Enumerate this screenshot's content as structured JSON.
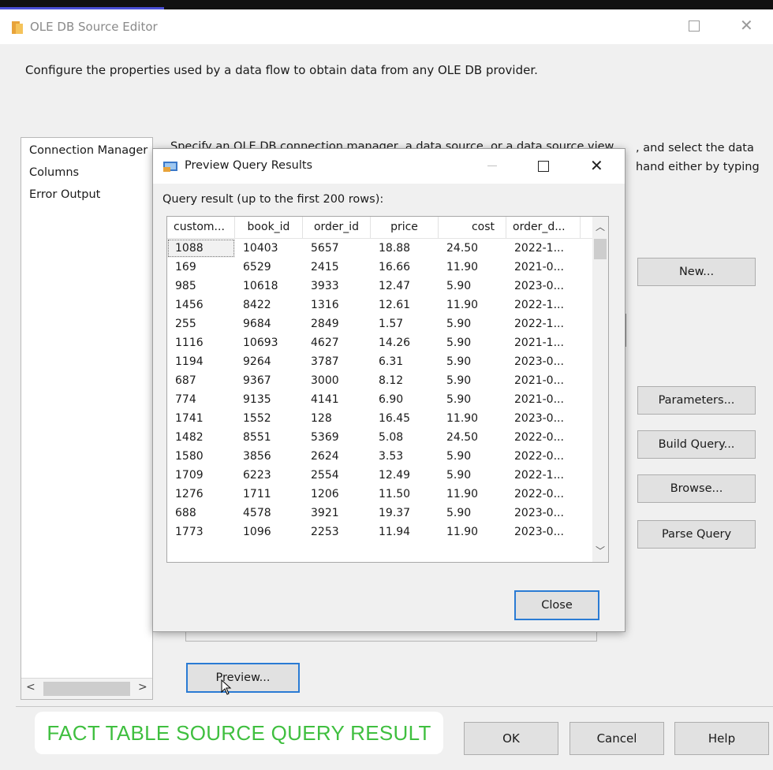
{
  "window": {
    "title": "OLE DB Source Editor",
    "description": "Configure the properties used by a data flow to obtain data from any OLE DB provider."
  },
  "nav": {
    "items": [
      "Connection Manager",
      "Columns",
      "Error Output"
    ]
  },
  "background": {
    "partial_text_1": ", and select the data",
    "partial_text_2": "hand either by typing",
    "partial_text_behind": "Specify an OLE DB connection manager, a data source, or a data source view",
    "buttons": {
      "new": "New...",
      "parameters": "Parameters...",
      "build_query": "Build Query...",
      "browse": "Browse...",
      "parse_query": "Parse Query"
    },
    "preview_label": "Preview..."
  },
  "modal": {
    "title": "Preview Query Results",
    "query_label": "Query result (up to the first 200 rows):",
    "columns": [
      "custom...",
      "book_id",
      "order_id",
      "price",
      "cost",
      "order_d..."
    ],
    "rows": [
      [
        "1088",
        "10403",
        "5657",
        "18.88",
        "24.50",
        "2022-1..."
      ],
      [
        "169",
        "6529",
        "2415",
        "16.66",
        "11.90",
        "2021-0..."
      ],
      [
        "985",
        "10618",
        "3933",
        "12.47",
        "5.90",
        "2023-0..."
      ],
      [
        "1456",
        "8422",
        "1316",
        "12.61",
        "11.90",
        "2022-1..."
      ],
      [
        "255",
        "9684",
        "2849",
        "1.57",
        "5.90",
        "2022-1..."
      ],
      [
        "1116",
        "10693",
        "4627",
        "14.26",
        "5.90",
        "2021-1..."
      ],
      [
        "1194",
        "9264",
        "3787",
        "6.31",
        "5.90",
        "2023-0..."
      ],
      [
        "687",
        "9367",
        "3000",
        "8.12",
        "5.90",
        "2021-0..."
      ],
      [
        "774",
        "9135",
        "4141",
        "6.90",
        "5.90",
        "2021-0..."
      ],
      [
        "1741",
        "1552",
        "128",
        "16.45",
        "11.90",
        "2023-0..."
      ],
      [
        "1482",
        "8551",
        "5369",
        "5.08",
        "24.50",
        "2022-0..."
      ],
      [
        "1580",
        "3856",
        "2624",
        "3.53",
        "5.90",
        "2022-0..."
      ],
      [
        "1709",
        "6223",
        "2554",
        "12.49",
        "5.90",
        "2022-1..."
      ],
      [
        "1276",
        "1711",
        "1206",
        "11.50",
        "11.90",
        "2022-0..."
      ],
      [
        "688",
        "4578",
        "3921",
        "19.37",
        "5.90",
        "2023-0..."
      ],
      [
        "1773",
        "1096",
        "2253",
        "11.94",
        "11.90",
        "2023-0..."
      ]
    ],
    "close_label": "Close"
  },
  "footer": {
    "ok": "OK",
    "cancel": "Cancel",
    "help": "Help",
    "caption": "FACT TABLE SOURCE QUERY RESULT"
  },
  "colors": {
    "accent": "#2a7bd4",
    "caption_text": "#3fbf3f"
  }
}
